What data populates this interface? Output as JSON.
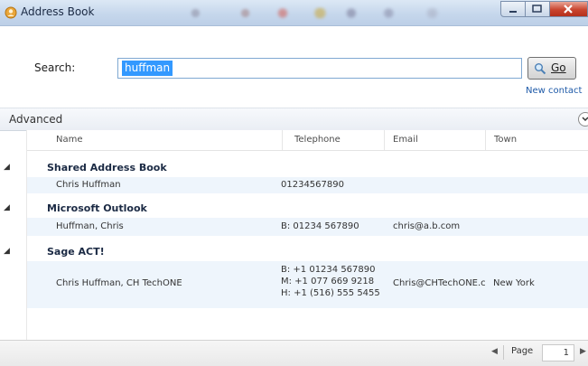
{
  "window": {
    "title": "Address Book",
    "icon": "address-book-icon"
  },
  "search": {
    "label": "Search:",
    "value": "huffman",
    "go_label": "Go",
    "go_icon": "magnifier-icon",
    "new_contact": "New contact"
  },
  "advanced": {
    "label": "Advanced",
    "toggle_icon": "chevron-down-icon"
  },
  "grid": {
    "columns": [
      "Name",
      "Telephone",
      "Email",
      "Town"
    ],
    "groups": [
      {
        "title": "Shared Address Book",
        "rows": [
          {
            "name": "Chris Huffman",
            "telephone": [
              "01234567890"
            ],
            "email": "",
            "town": ""
          }
        ]
      },
      {
        "title": "Microsoft Outlook",
        "rows": [
          {
            "name": "Huffman, Chris",
            "telephone": [
              "B: 01234 567890"
            ],
            "email": "chris@a.b.com",
            "town": ""
          }
        ]
      },
      {
        "title": "Sage ACT!",
        "rows": [
          {
            "name": "Chris Huffman, CH TechONE",
            "telephone": [
              "B: +1 01234 567890",
              "M: +1 077 669 9218",
              "H: +1 (516) 555 5455"
            ],
            "email": "Chris@CHTechONE.c",
            "town": "New York"
          }
        ]
      }
    ]
  },
  "pager": {
    "page_label": "Page",
    "page_value": "1"
  }
}
